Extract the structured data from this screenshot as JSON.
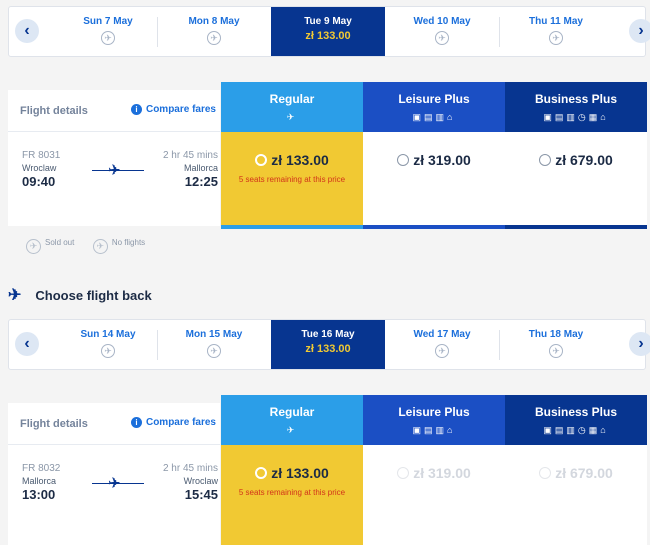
{
  "outbound": {
    "dates": [
      {
        "label": "Sun 7 May",
        "price": null,
        "selected": false
      },
      {
        "label": "Mon 8 May",
        "price": null,
        "selected": false
      },
      {
        "label": "Tue 9 May",
        "price": "zł 133.00",
        "selected": true
      },
      {
        "label": "Wed 10 May",
        "price": null,
        "selected": false
      },
      {
        "label": "Thu 11 May",
        "price": null,
        "selected": false
      }
    ],
    "details_label": "Flight details",
    "compare_label": "Compare fares",
    "flight_number": "FR 8031",
    "duration": "2 hr 45 mins",
    "origin_city": "Wroclaw",
    "dest_city": "Mallorca",
    "depart_time": "09:40",
    "arrive_time": "12:25",
    "fares": [
      {
        "name": "Regular",
        "price": "zł 133.00",
        "seats": "5 seats remaining at this price"
      },
      {
        "name": "Leisure Plus",
        "price": "zł 319.00"
      },
      {
        "name": "Business Plus",
        "price": "zł 679.00"
      }
    ]
  },
  "legend": {
    "sold_out": "Sold out",
    "no_flights": "No flights"
  },
  "return_section": {
    "title": "Choose flight back"
  },
  "inbound": {
    "dates": [
      {
        "label": "Sun 14 May",
        "price": null,
        "selected": false
      },
      {
        "label": "Mon 15 May",
        "price": null,
        "selected": false
      },
      {
        "label": "Tue 16 May",
        "price": "zł 133.00",
        "selected": true
      },
      {
        "label": "Wed 17 May",
        "price": null,
        "selected": false
      },
      {
        "label": "Thu 18 May",
        "price": null,
        "selected": false
      }
    ],
    "details_label": "Flight details",
    "compare_label": "Compare fares",
    "flight_number": "FR 8032",
    "duration": "2 hr 45 mins",
    "origin_city": "Mallorca",
    "dest_city": "Wroclaw",
    "depart_time": "13:00",
    "arrive_time": "15:45",
    "fares": [
      {
        "name": "Regular",
        "price": "zł 133.00",
        "seats": "5 seats remaining at this price"
      },
      {
        "name": "Leisure Plus",
        "price": "zł 319.00"
      },
      {
        "name": "Business Plus",
        "price": "zł 679.00"
      }
    ]
  },
  "colors": {
    "navy": "#073590",
    "blue": "#1b6fdb",
    "regular": "#2b9ee8",
    "leisure": "#1b4fc4",
    "selected_fare": "#f1c933",
    "warning": "#d2341a"
  },
  "icons": {
    "no_flight": "no-flights-icon",
    "plane": "plane-icon",
    "info": "info-icon",
    "prev": "chevron-left-icon",
    "next": "chevron-right-icon"
  }
}
